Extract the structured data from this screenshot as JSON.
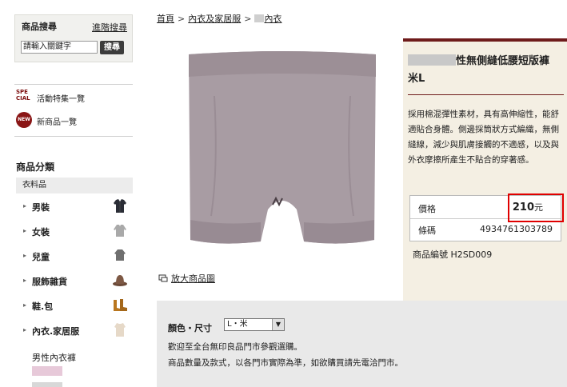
{
  "search": {
    "title": "商品搜尋",
    "advanced_link": "進階搜尋",
    "input_value": "請輸入關鍵字",
    "button_label": "搜尋"
  },
  "sidebar": {
    "special": {
      "badge": "SPE CIAL",
      "label": "活動特集一覽"
    },
    "new": {
      "badge": "NEW",
      "label": "新商品一覽"
    },
    "category_heading": "商品分類",
    "category_sub": "衣料品",
    "items": [
      {
        "label": "男裝",
        "icon": "jacket-icon"
      },
      {
        "label": "女裝",
        "icon": "sweater-icon"
      },
      {
        "label": "兒童",
        "icon": "kids-coat-icon"
      },
      {
        "label": "服飾雜貨",
        "icon": "hat-icon"
      },
      {
        "label": "鞋.包",
        "icon": "boots-icon"
      },
      {
        "label": "內衣.家居服",
        "icon": "top-icon"
      }
    ],
    "active_subcategory": "男性內衣褲"
  },
  "breadcrumb": {
    "home": "首頁",
    "category": "內衣及家居服",
    "current_suffix": "內衣",
    "separator": ">"
  },
  "product": {
    "title_visible": "性無側縫低腰短版褲",
    "title_line2": "米L",
    "description": "採用棉混彈性素材，具有高伸縮性，能舒適貼合身體。側邊採筒狀方式編織，無側縫線，減少與肌膚接觸的不適感，以及與外衣摩擦所產生不貼合的穿著感。",
    "price_label": "價格",
    "price_value": "210",
    "price_unit": "元",
    "jan_label": "條碼",
    "jan_value": "4934761303789",
    "code": "商品編號 H2SD009",
    "enlarge_label": "放大商品圖"
  },
  "options": {
    "label": "顏色・尺寸",
    "selected": "L・米",
    "notice_1": "歡迎至全台無印良品門市參觀選購。",
    "notice_2": "商品數量及款式，以各門市實際為準，如欲購買請先電洽門市。"
  },
  "colors": {
    "accent": "#6e1b1b",
    "panel_bg": "#f4efe3",
    "highlight": "#e00000",
    "garment": "#a89ca3"
  }
}
